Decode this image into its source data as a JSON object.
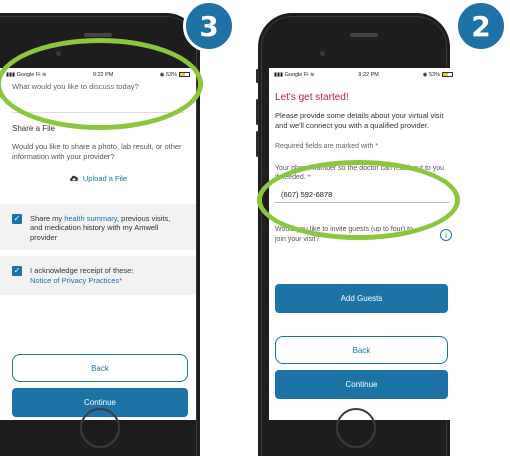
{
  "badges": {
    "left": "3",
    "right": "2"
  },
  "left_screen": {
    "status": {
      "carrier": "Google Fi",
      "time": "9:22 PM",
      "battery": "53%"
    },
    "discuss_prompt": "What would you like to discuss today?",
    "share_heading": "Share a File",
    "share_text": "Would you like to share a photo, lab result, or other information with your provider?",
    "upload_label": "Upload a File",
    "consent_1_pre": "Share my ",
    "consent_1_link": "health summary",
    "consent_1_post": ", previous visits, and medication history with my Amwell provider",
    "consent_2_text": "I acknowledge receipt of these:",
    "consent_2_link": "Notice of Privacy Practices",
    "consent_2_req": "*",
    "back_label": "Back",
    "continue_label": "Continue"
  },
  "right_screen": {
    "status": {
      "carrier": "Google Fi",
      "time": "9:22 PM",
      "battery": "53%"
    },
    "title": "Let's get started!",
    "intro": "Please provide some details about your virtual visit and we'll connect you with a qualified provider.",
    "required_note": "Required fields are marked with *",
    "phone_label": "Your phone number so the doctor can reach out to you if needed. *",
    "phone_value": "(607) 592-6878",
    "guests_question": "Would you like to invite guests (up to four) to join your visit?",
    "info_icon": "i",
    "add_guests_label": "Add Guests",
    "back_label": "Back",
    "continue_label": "Continue"
  },
  "colors": {
    "accent": "#1d73a6",
    "highlight": "#8cc63f",
    "title": "#c2185b"
  }
}
